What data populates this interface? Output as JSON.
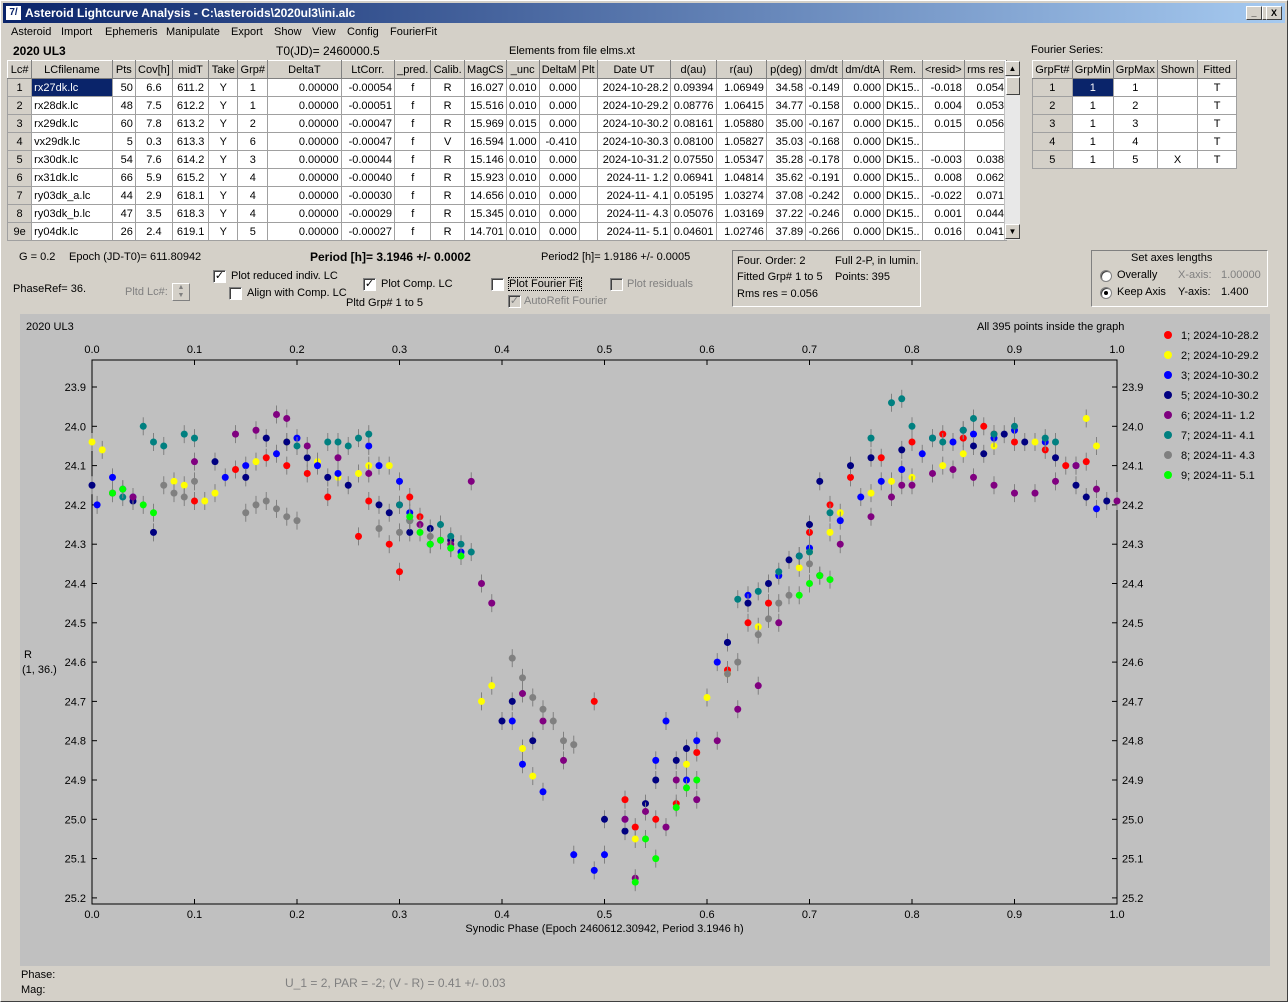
{
  "window": {
    "title": "Asteroid Lightcurve Analysis - C:\\asteroids\\2020ul3\\ini.alc",
    "min": "_",
    "max": "□",
    "close": "X"
  },
  "menu": [
    "Asteroid",
    "Import",
    "Ephemeris",
    "Manipulate",
    "Export",
    "Show",
    "View",
    "Config",
    "FourierFit"
  ],
  "header": {
    "object": "2020 UL3",
    "t0": "T0(JD)= 2460000.5",
    "elements": "Elements from file elms.xt",
    "fourier_label": "Fourier Series:"
  },
  "lc_table": {
    "columns": [
      "Lc#",
      "LCfilename",
      "Pts",
      "Cov[h]",
      "midT",
      "Take",
      "Grp#",
      "DeltaT",
      "LtCorr.",
      "_pred.",
      "Calib.",
      "MagCS",
      "_unc",
      "DeltaM",
      "Plt",
      "Date UT",
      "d(au)",
      "r(au)",
      "p(deg)",
      "dm/dt",
      "dm/dtA",
      "Rem.",
      "<resid>",
      "rms res"
    ],
    "rows": [
      [
        "1",
        "rx27dk.lc",
        "50",
        "6.6",
        "611.2",
        "Y",
        "1",
        "0.00000",
        "-0.00054",
        "f",
        "R",
        "16.027",
        "0.010",
        "0.000",
        "",
        "2024-10-28.2",
        "0.09394",
        "1.06949",
        "34.58",
        "-0.149",
        "0.000",
        "DK15..",
        "-0.018",
        "0.054"
      ],
      [
        "2",
        "rx28dk.lc",
        "48",
        "7.5",
        "612.2",
        "Y",
        "1",
        "0.00000",
        "-0.00051",
        "f",
        "R",
        "15.516",
        "0.010",
        "0.000",
        "",
        "2024-10-29.2",
        "0.08776",
        "1.06415",
        "34.77",
        "-0.158",
        "0.000",
        "DK15..",
        "0.004",
        "0.053"
      ],
      [
        "3",
        "rx29dk.lc",
        "60",
        "7.8",
        "613.2",
        "Y",
        "2",
        "0.00000",
        "-0.00047",
        "f",
        "R",
        "15.969",
        "0.015",
        "0.000",
        "",
        "2024-10-30.2",
        "0.08161",
        "1.05880",
        "35.00",
        "-0.167",
        "0.000",
        "DK15..",
        "0.015",
        "0.056"
      ],
      [
        "4",
        "vx29dk.lc",
        "5",
        "0.3",
        "613.3",
        "Y",
        "6",
        "0.00000",
        "-0.00047",
        "f",
        "V",
        "16.594",
        "1.000",
        "-0.410",
        "",
        "2024-10-30.3",
        "0.08100",
        "1.05827",
        "35.03",
        "-0.168",
        "0.000",
        "DK15..",
        "",
        ""
      ],
      [
        "5",
        "rx30dk.lc",
        "54",
        "7.6",
        "614.2",
        "Y",
        "3",
        "0.00000",
        "-0.00044",
        "f",
        "R",
        "15.146",
        "0.010",
        "0.000",
        "",
        "2024-10-31.2",
        "0.07550",
        "1.05347",
        "35.28",
        "-0.178",
        "0.000",
        "DK15..",
        "-0.003",
        "0.038"
      ],
      [
        "6",
        "rx31dk.lc",
        "66",
        "5.9",
        "615.2",
        "Y",
        "4",
        "0.00000",
        "-0.00040",
        "f",
        "R",
        "15.923",
        "0.010",
        "0.000",
        "",
        "2024-11- 1.2",
        "0.06941",
        "1.04814",
        "35.62",
        "-0.191",
        "0.000",
        "DK15..",
        "0.008",
        "0.062"
      ],
      [
        "7",
        "ry03dk_a.lc",
        "44",
        "2.9",
        "618.1",
        "Y",
        "4",
        "0.00000",
        "-0.00030",
        "f",
        "R",
        "14.656",
        "0.010",
        "0.000",
        "",
        "2024-11- 4.1",
        "0.05195",
        "1.03274",
        "37.08",
        "-0.242",
        "0.000",
        "DK15..",
        "-0.022",
        "0.071"
      ],
      [
        "8",
        "ry03dk_b.lc",
        "47",
        "3.5",
        "618.3",
        "Y",
        "4",
        "0.00000",
        "-0.00029",
        "f",
        "R",
        "15.345",
        "0.010",
        "0.000",
        "",
        "2024-11- 4.3",
        "0.05076",
        "1.03169",
        "37.22",
        "-0.246",
        "0.000",
        "DK15..",
        "0.001",
        "0.044"
      ],
      [
        "9e",
        "ry04dk.lc",
        "26",
        "2.4",
        "619.1",
        "Y",
        "5",
        "0.00000",
        "-0.00027",
        "f",
        "R",
        "14.701",
        "0.010",
        "0.000",
        "",
        "2024-11- 5.1",
        "0.04601",
        "1.02746",
        "37.89",
        "-0.266",
        "0.000",
        "DK15..",
        "0.016",
        "0.041"
      ]
    ]
  },
  "fourier_table": {
    "columns": [
      "GrpFt#",
      "GrpMin",
      "GrpMax",
      "Shown",
      "Fitted"
    ],
    "rows": [
      [
        "1",
        "1",
        "1",
        "",
        "T"
      ],
      [
        "2",
        "1",
        "2",
        "",
        "T"
      ],
      [
        "3",
        "1",
        "3",
        "",
        "T"
      ],
      [
        "4",
        "1",
        "4",
        "",
        "T"
      ],
      [
        "5",
        "1",
        "5",
        "X",
        "T"
      ]
    ]
  },
  "controls": {
    "g": "G = 0.2",
    "epoch": "Epoch (JD-T0)= 611.80942",
    "period": "Period [h]= 3.1946 +/- 0.0002",
    "period2": "Period2 [h]= 1.9186 +/- 0.0005",
    "phaseref": "PhaseRef= 36.",
    "pltd_lc": "Pltd Lc#:",
    "plot_reduced": "Plot reduced indiv. LC",
    "align_comp": "Align with Comp. LC",
    "plot_comp": "Plot Comp. LC",
    "pltd_grp": "Pltd Grp#  1   to   5",
    "plot_fourier": "Plot Fourier Fit",
    "autorefit": "AutoRefit Fourier",
    "plot_residuals": "Plot residuals",
    "four_order": "Four. Order:  2",
    "full2p": "Full 2-P, in lumin.",
    "fitted_grp": "Fitted Grp# 1 to 5",
    "points": "Points: 395",
    "rms_res": "Rms res      = 0.056",
    "axes_title": "Set axes lengths",
    "overally": "Overally",
    "keep_axis": "Keep Axis",
    "xaxis_label": "X-axis:",
    "xaxis_val": "1.00000",
    "yaxis_label": "Y-axis:",
    "yaxis_val": "1.400"
  },
  "footer": {
    "phase": "Phase:",
    "mag": "Mag:",
    "params": "U_1 = 2, PAR = -2; (V - R) = 0.41 +/- 0.03"
  },
  "chart_data": {
    "type": "scatter",
    "title": "2020 UL3",
    "note": "All 395 points inside the graph",
    "xlabel": "Synodic Phase (Epoch 2460612.30942, Period 3.1946 h)",
    "ylabel": "R",
    "ylabel2": "(1, 36.)",
    "xlim": [
      0,
      1
    ],
    "ylim": [
      25.25,
      23.85
    ],
    "inverted_y": true,
    "xticks": [
      "0.0",
      "0.1",
      "0.2",
      "0.3",
      "0.4",
      "0.5",
      "0.6",
      "0.7",
      "0.8",
      "0.9",
      "1.0"
    ],
    "yticks": [
      "23.9",
      "24.0",
      "24.1",
      "24.2",
      "24.3",
      "24.4",
      "24.5",
      "24.6",
      "24.7",
      "24.8",
      "24.9",
      "25.0",
      "25.1",
      "25.2"
    ],
    "legend": "top-right",
    "series": [
      {
        "name": "1; 2024-10-28.2",
        "color": "#ff0000",
        "x": [
          0.1,
          0.14,
          0.17,
          0.19,
          0.21,
          0.23,
          0.26,
          0.27,
          0.29,
          0.3,
          0.31,
          0.32,
          0.49,
          0.52,
          0.53,
          0.55,
          0.57,
          0.59,
          0.62,
          0.64,
          0.66,
          0.7,
          0.72,
          0.74,
          0.77,
          0.8,
          0.83,
          0.85,
          0.87,
          0.88,
          0.9,
          0.93,
          0.95,
          0.97
        ],
        "y": [
          24.19,
          24.11,
          24.08,
          24.1,
          24.12,
          24.18,
          24.28,
          24.19,
          24.3,
          24.37,
          24.18,
          24.23,
          24.7,
          24.95,
          25.02,
          25.0,
          24.96,
          24.83,
          24.62,
          24.5,
          24.45,
          24.27,
          24.2,
          24.13,
          24.08,
          24.04,
          24.02,
          24.03,
          24.0,
          24.02,
          24.04,
          24.06,
          24.1,
          24.09
        ]
      },
      {
        "name": "2; 2024-10-29.2",
        "color": "#ffff00",
        "x": [
          0.0,
          0.01,
          0.08,
          0.09,
          0.11,
          0.12,
          0.16,
          0.19,
          0.22,
          0.24,
          0.26,
          0.27,
          0.29,
          0.38,
          0.39,
          0.42,
          0.43,
          0.53,
          0.58,
          0.6,
          0.62,
          0.65,
          0.69,
          0.7,
          0.72,
          0.73,
          0.76,
          0.78,
          0.8,
          0.83,
          0.85,
          0.88,
          0.92,
          0.97,
          0.98
        ],
        "y": [
          24.04,
          24.06,
          24.14,
          24.15,
          24.19,
          24.17,
          24.09,
          24.04,
          24.09,
          24.13,
          24.12,
          24.1,
          24.1,
          24.7,
          24.66,
          24.82,
          24.89,
          25.05,
          24.86,
          24.69,
          24.63,
          24.51,
          24.36,
          24.32,
          24.27,
          24.22,
          24.17,
          24.14,
          24.13,
          24.1,
          24.07,
          24.05,
          24.04,
          23.98,
          24.05
        ]
      },
      {
        "name": "3; 2024-10-30.2",
        "color": "#0000ff",
        "x": [
          0.005,
          0.02,
          0.03,
          0.04,
          0.13,
          0.15,
          0.18,
          0.2,
          0.22,
          0.24,
          0.27,
          0.28,
          0.3,
          0.31,
          0.33,
          0.36,
          0.41,
          0.42,
          0.44,
          0.47,
          0.49,
          0.5,
          0.52,
          0.55,
          0.56,
          0.58,
          0.59,
          0.61,
          0.62,
          0.64,
          0.67,
          0.69,
          0.7,
          0.73,
          0.75,
          0.77,
          0.79,
          0.81,
          0.84,
          0.86,
          0.88,
          0.9,
          0.93,
          0.96,
          0.98
        ],
        "y": [
          24.2,
          24.13,
          24.16,
          24.18,
          24.13,
          24.1,
          24.07,
          24.03,
          24.1,
          24.12,
          24.05,
          24.1,
          24.14,
          24.22,
          24.3,
          24.32,
          24.75,
          24.86,
          24.93,
          25.09,
          25.13,
          25.09,
          25.0,
          24.85,
          24.75,
          24.9,
          24.8,
          24.6,
          24.55,
          24.43,
          24.38,
          24.33,
          24.31,
          24.24,
          24.18,
          24.14,
          24.11,
          24.07,
          24.04,
          24.02,
          24.03,
          24.01,
          24.04,
          24.1,
          24.21
        ]
      },
      {
        "name": "5; 2024-10-30.2",
        "color": "#000080",
        "x": [
          0.0,
          0.04,
          0.06,
          0.12,
          0.15,
          0.17,
          0.19,
          0.21,
          0.23,
          0.25,
          0.28,
          0.29,
          0.31,
          0.33,
          0.35,
          0.4,
          0.41,
          0.43,
          0.5,
          0.52,
          0.54,
          0.55,
          0.57,
          0.58,
          0.62,
          0.64,
          0.66,
          0.68,
          0.7,
          0.71,
          0.74,
          0.76,
          0.79,
          0.82,
          0.85,
          0.86,
          0.87,
          0.89,
          0.91,
          0.94,
          0.96,
          0.97,
          0.99
        ],
        "y": [
          24.15,
          24.19,
          24.27,
          24.09,
          24.13,
          24.03,
          24.04,
          24.08,
          24.13,
          24.15,
          24.2,
          24.22,
          24.27,
          24.26,
          24.29,
          24.75,
          24.7,
          24.8,
          25.0,
          25.03,
          24.96,
          24.9,
          24.85,
          24.82,
          24.55,
          24.45,
          24.4,
          24.34,
          24.25,
          24.14,
          24.1,
          24.08,
          24.06,
          24.03,
          24.01,
          24.05,
          24.07,
          24.02,
          24.04,
          24.08,
          24.15,
          24.18,
          24.19
        ]
      },
      {
        "name": "6; 2024-11- 1.2",
        "color": "#800080",
        "x": [
          0.02,
          0.04,
          0.1,
          0.14,
          0.16,
          0.18,
          0.19,
          0.21,
          0.24,
          0.27,
          0.3,
          0.32,
          0.35,
          0.37,
          0.38,
          0.39,
          0.42,
          0.44,
          0.46,
          0.52,
          0.53,
          0.54,
          0.56,
          0.57,
          0.59,
          0.61,
          0.63,
          0.65,
          0.67,
          0.71,
          0.73,
          0.76,
          0.78,
          0.79,
          0.8,
          0.82,
          0.84,
          0.86,
          0.88,
          0.9,
          0.92,
          0.94,
          0.96,
          0.98,
          1.0
        ],
        "y": [
          24.17,
          24.18,
          24.09,
          24.02,
          24.01,
          23.97,
          23.98,
          24.05,
          24.08,
          24.12,
          24.2,
          24.25,
          24.3,
          24.14,
          24.4,
          24.45,
          24.68,
          24.75,
          24.85,
          25.0,
          25.15,
          24.98,
          25.02,
          24.9,
          24.95,
          24.8,
          24.72,
          24.66,
          24.5,
          24.38,
          24.3,
          24.23,
          24.18,
          24.15,
          24.15,
          24.12,
          24.11,
          24.13,
          24.15,
          24.17,
          24.17,
          24.14,
          24.1,
          24.16,
          24.19
        ]
      },
      {
        "name": "7; 2024-11- 4.1",
        "color": "#008080",
        "x": [
          0.03,
          0.05,
          0.06,
          0.07,
          0.09,
          0.1,
          0.2,
          0.23,
          0.24,
          0.25,
          0.26,
          0.27,
          0.3,
          0.31,
          0.34,
          0.35,
          0.36,
          0.37,
          0.63,
          0.65,
          0.67,
          0.69,
          0.7,
          0.72,
          0.76,
          0.78,
          0.79,
          0.8,
          0.82,
          0.83,
          0.85,
          0.86,
          0.88,
          0.9,
          0.93,
          0.94
        ],
        "y": [
          24.18,
          24.0,
          24.04,
          24.05,
          24.02,
          24.03,
          24.05,
          24.04,
          24.04,
          24.05,
          24.03,
          24.02,
          24.2,
          24.24,
          24.25,
          24.28,
          24.3,
          24.32,
          24.44,
          24.42,
          24.37,
          24.33,
          24.32,
          24.22,
          24.03,
          23.94,
          23.93,
          24.0,
          24.03,
          24.04,
          24.01,
          23.98,
          24.02,
          24.0,
          24.03,
          24.04
        ]
      },
      {
        "name": "8; 2024-11- 4.3",
        "color": "#808080",
        "x": [
          0.07,
          0.08,
          0.09,
          0.1,
          0.15,
          0.16,
          0.17,
          0.18,
          0.19,
          0.2,
          0.28,
          0.3,
          0.31,
          0.33,
          0.34,
          0.35,
          0.41,
          0.42,
          0.43,
          0.44,
          0.45,
          0.46,
          0.47,
          0.62,
          0.63,
          0.65,
          0.66,
          0.67,
          0.68,
          0.7
        ],
        "y": [
          24.15,
          24.17,
          24.18,
          24.14,
          24.22,
          24.2,
          24.19,
          24.21,
          24.23,
          24.24,
          24.26,
          24.27,
          24.24,
          24.28,
          24.29,
          24.31,
          24.59,
          24.64,
          24.69,
          24.72,
          24.75,
          24.8,
          24.81,
          24.63,
          24.6,
          24.53,
          24.49,
          24.45,
          24.43,
          24.35
        ]
      },
      {
        "name": "9; 2024-11- 5.1",
        "color": "#00ff00",
        "x": [
          0.02,
          0.03,
          0.05,
          0.06,
          0.31,
          0.32,
          0.33,
          0.34,
          0.35,
          0.36,
          0.53,
          0.54,
          0.55,
          0.57,
          0.58,
          0.59,
          0.69,
          0.7,
          0.71,
          0.72
        ],
        "y": [
          24.17,
          24.16,
          24.2,
          24.22,
          24.23,
          24.27,
          24.3,
          24.29,
          24.31,
          24.33,
          25.16,
          25.05,
          25.1,
          24.97,
          24.92,
          24.9,
          24.43,
          24.4,
          24.38,
          24.39
        ]
      }
    ]
  }
}
